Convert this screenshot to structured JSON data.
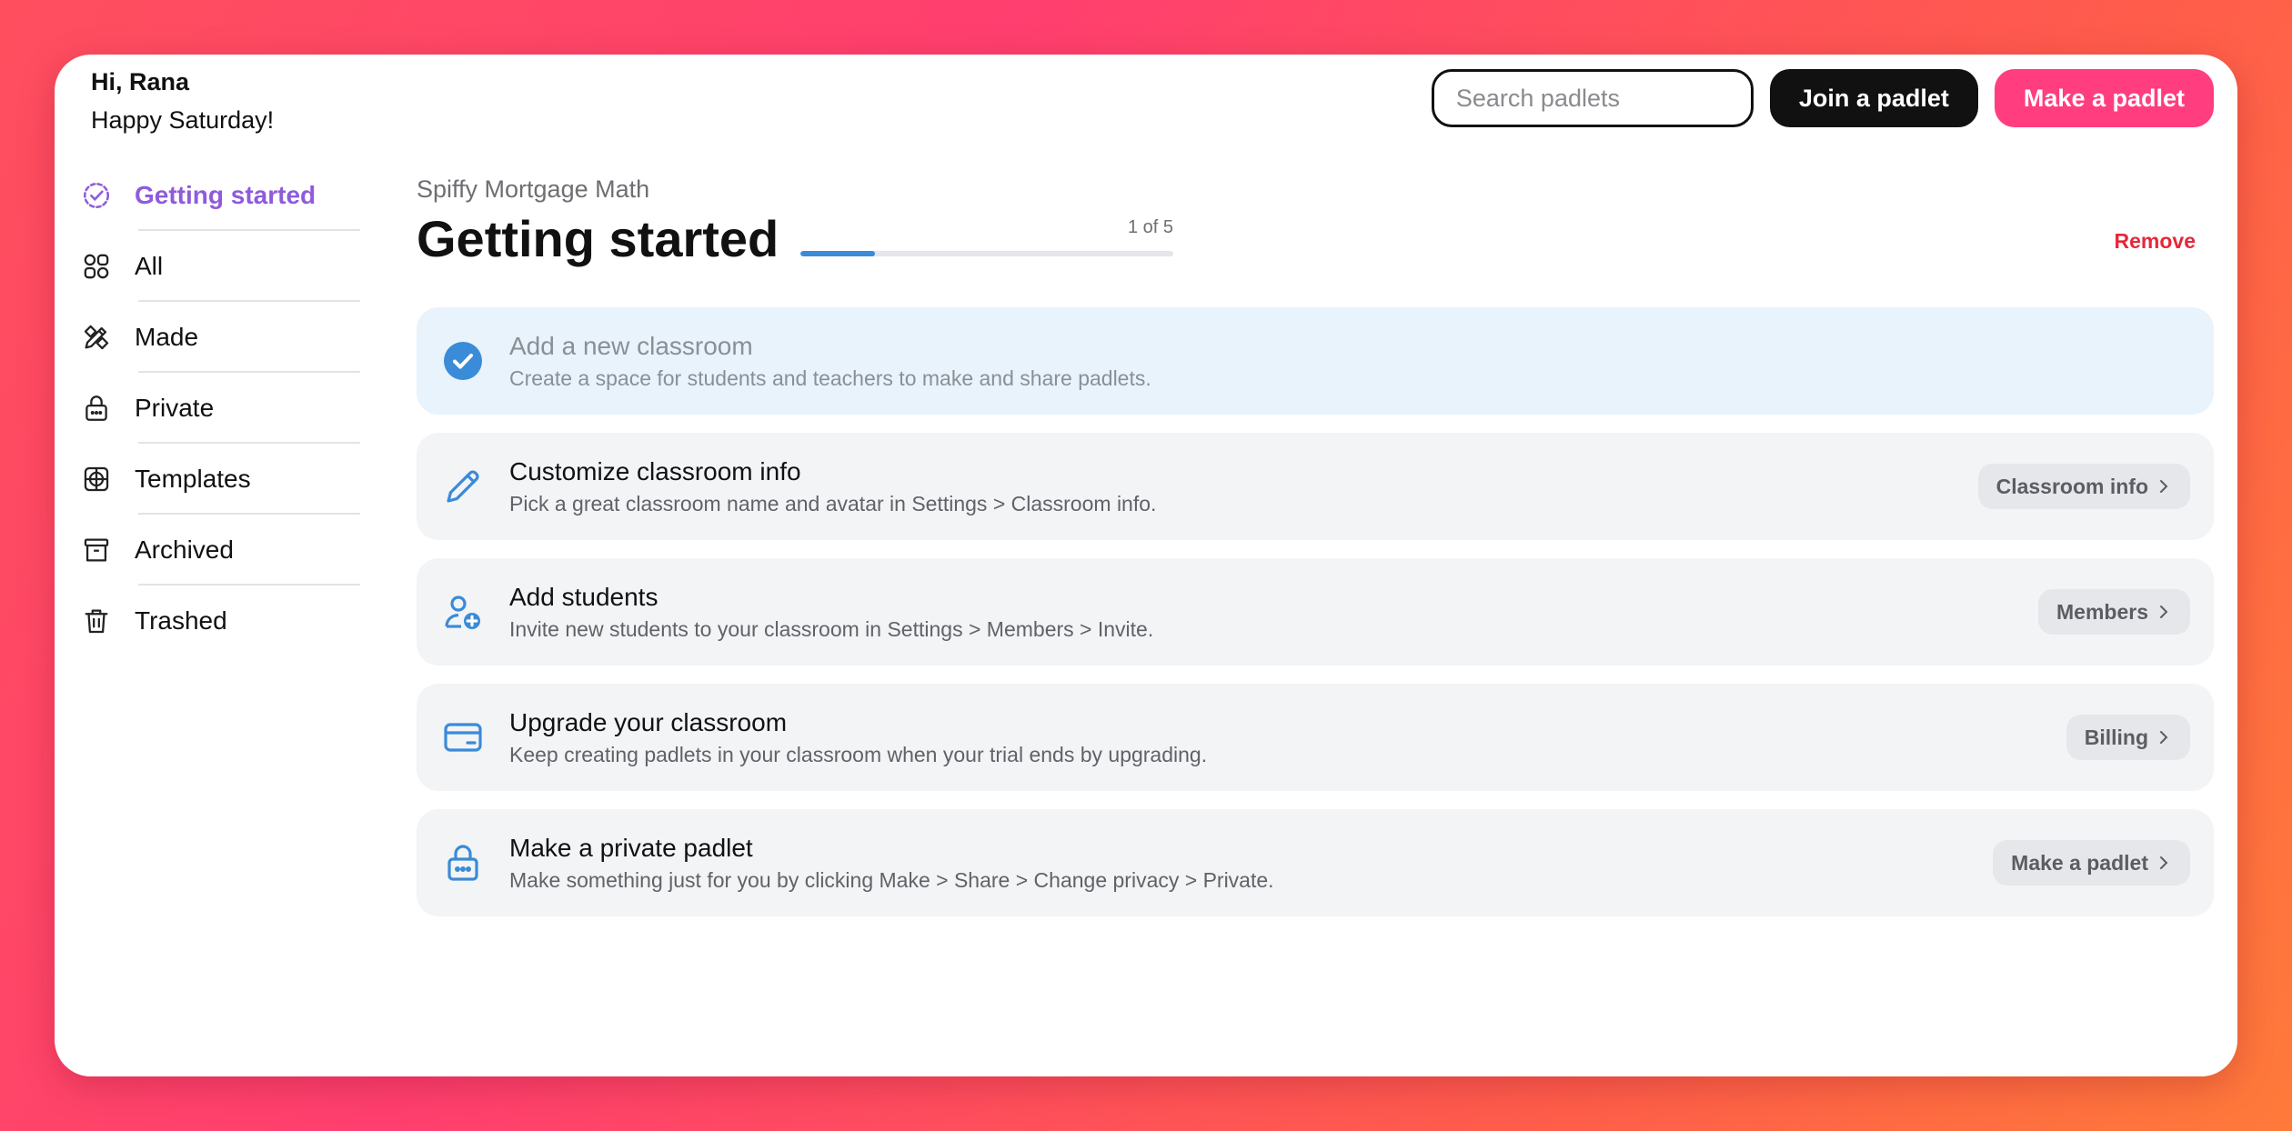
{
  "header": {
    "greeting": "Hi, Rana",
    "day_message": "Happy Saturday!",
    "search_placeholder": "Search padlets",
    "join_label": "Join a padlet",
    "make_label": "Make a padlet"
  },
  "sidebar": {
    "items": [
      {
        "label": "Getting started",
        "icon": "dashed-check-circle-icon",
        "active": true
      },
      {
        "label": "All",
        "icon": "grid-shapes-icon"
      },
      {
        "label": "Made",
        "icon": "pencil-ruler-icon"
      },
      {
        "label": "Private",
        "icon": "lock-icon"
      },
      {
        "label": "Templates",
        "icon": "template-grid-icon"
      },
      {
        "label": "Archived",
        "icon": "archive-box-icon"
      },
      {
        "label": "Trashed",
        "icon": "trash-icon"
      }
    ]
  },
  "main": {
    "org_name": "Spiffy Mortgage Math",
    "title": "Getting started",
    "progress_label": "1 of 5",
    "progress_fraction": 0.2,
    "remove_label": "Remove",
    "tasks": [
      {
        "title": "Add a new classroom",
        "desc": "Create a space for students and teachers to make and share padlets.",
        "done": true,
        "icon": "check-circle-icon"
      },
      {
        "title": "Customize classroom info",
        "desc": "Pick a great classroom name and avatar in Settings > Classroom info.",
        "action": "Classroom info",
        "icon": "pencil-icon"
      },
      {
        "title": "Add students",
        "desc": "Invite new students to your classroom in Settings > Members > Invite.",
        "action": "Members",
        "icon": "user-add-icon"
      },
      {
        "title": "Upgrade your classroom",
        "desc": "Keep creating padlets in your classroom when your trial ends by upgrading.",
        "action": "Billing",
        "icon": "credit-card-icon"
      },
      {
        "title": "Make a private padlet",
        "desc": "Make something just for you by clicking Make > Share > Change privacy > Private.",
        "action": "Make a padlet",
        "icon": "lock-icon"
      }
    ]
  },
  "colors": {
    "accent_purple": "#8f5bdc",
    "accent_blue": "#3a8bd8",
    "brand_pink": "#ff3d7f",
    "danger_red": "#e5283a"
  }
}
